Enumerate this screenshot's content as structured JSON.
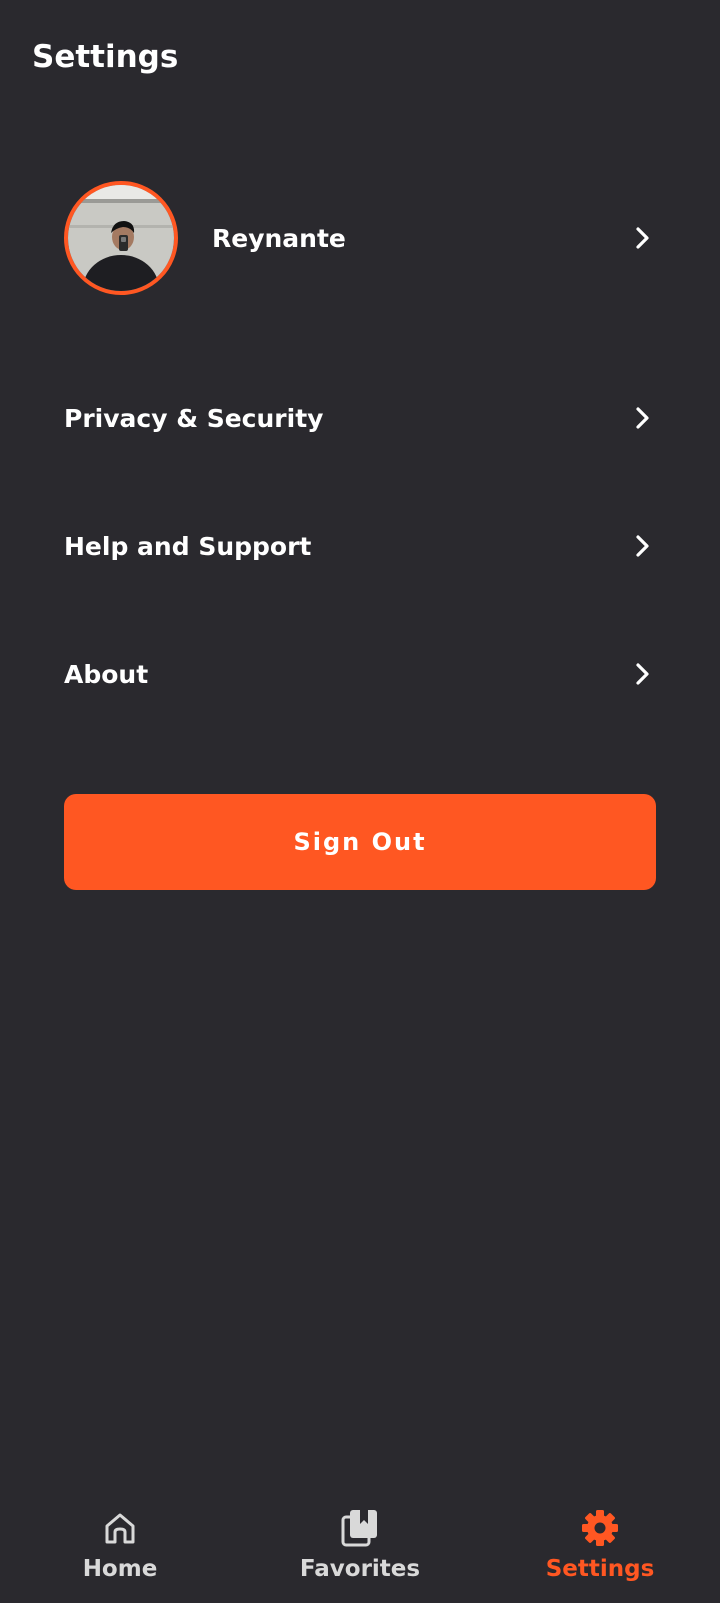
{
  "header": {
    "title": "Settings"
  },
  "profile": {
    "name": "Reynante"
  },
  "menu": {
    "items": [
      {
        "label": "Privacy & Security"
      },
      {
        "label": "Help and Support"
      },
      {
        "label": "About"
      }
    ]
  },
  "signout": {
    "label": "Sign Out"
  },
  "bottom_nav": {
    "items": [
      {
        "label": "Home",
        "icon": "home-icon"
      },
      {
        "label": "Favorites",
        "icon": "bookmark-icon"
      },
      {
        "label": "Settings",
        "icon": "gear-icon",
        "active": true
      }
    ]
  },
  "colors": {
    "background": "#2a292e",
    "accent": "#ff5722",
    "text": "#ffffff"
  }
}
